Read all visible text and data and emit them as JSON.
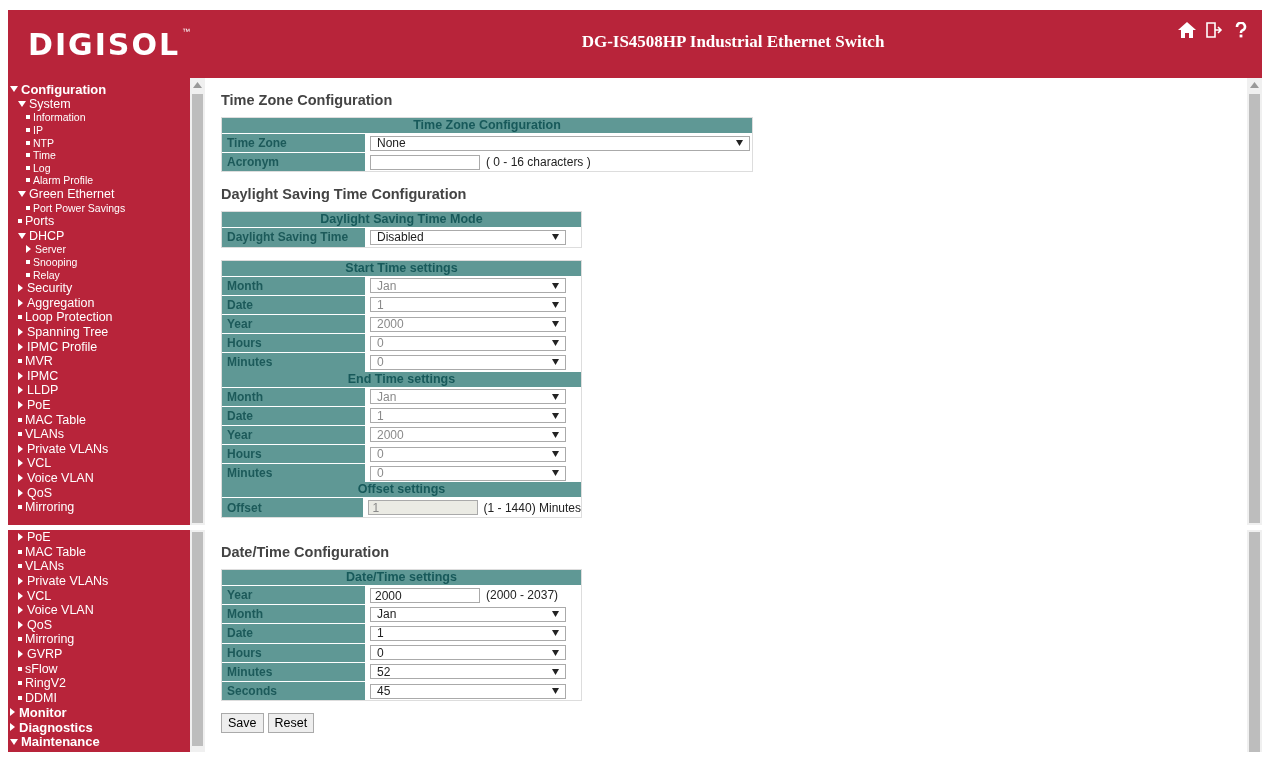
{
  "header": {
    "logo": "DIGISOL",
    "logo_mark": "™",
    "title": "DG-IS4508HP Industrial Ethernet Switch"
  },
  "top_panel": {
    "sidebar": {
      "items": [
        {
          "label": "Configuration",
          "kind": "folder",
          "expanded": true,
          "children": [
            {
              "label": "System",
              "kind": "folder",
              "expanded": true,
              "children": [
                {
                  "label": "Information",
                  "kind": "page"
                },
                {
                  "label": "IP",
                  "kind": "page"
                },
                {
                  "label": "NTP",
                  "kind": "page"
                },
                {
                  "label": "Time",
                  "kind": "page"
                },
                {
                  "label": "Log",
                  "kind": "page"
                },
                {
                  "label": "Alarm Profile",
                  "kind": "page"
                }
              ]
            },
            {
              "label": "Green Ethernet",
              "kind": "folder",
              "expanded": true,
              "children": [
                {
                  "label": "Port Power Savings",
                  "kind": "page"
                }
              ]
            },
            {
              "label": "Ports",
              "kind": "page"
            },
            {
              "label": "DHCP",
              "kind": "folder",
              "expanded": true,
              "children": [
                {
                  "label": "Server",
                  "kind": "folder",
                  "expanded": false
                },
                {
                  "label": "Snooping",
                  "kind": "page"
                },
                {
                  "label": "Relay",
                  "kind": "page"
                }
              ]
            },
            {
              "label": "Security",
              "kind": "folder",
              "expanded": false
            },
            {
              "label": "Aggregation",
              "kind": "folder",
              "expanded": false
            },
            {
              "label": "Loop Protection",
              "kind": "page"
            },
            {
              "label": "Spanning Tree",
              "kind": "folder",
              "expanded": false
            },
            {
              "label": "IPMC Profile",
              "kind": "folder",
              "expanded": false
            },
            {
              "label": "MVR",
              "kind": "page"
            },
            {
              "label": "IPMC",
              "kind": "folder",
              "expanded": false
            },
            {
              "label": "LLDP",
              "kind": "folder",
              "expanded": false
            },
            {
              "label": "PoE",
              "kind": "folder",
              "expanded": false
            },
            {
              "label": "MAC Table",
              "kind": "page"
            },
            {
              "label": "VLANs",
              "kind": "page"
            },
            {
              "label": "Private VLANs",
              "kind": "folder",
              "expanded": false
            },
            {
              "label": "VCL",
              "kind": "folder",
              "expanded": false
            },
            {
              "label": "Voice VLAN",
              "kind": "folder",
              "expanded": false
            },
            {
              "label": "QoS",
              "kind": "folder",
              "expanded": false
            },
            {
              "label": "Mirroring",
              "kind": "page"
            }
          ]
        }
      ]
    },
    "sections": [
      {
        "title": "Time Zone Configuration",
        "tables": [
          {
            "groups": [
              {
                "heading": "Time Zone Configuration",
                "rows": [
                  {
                    "label": "Time Zone",
                    "kind": "select",
                    "value": "None",
                    "disabled": false
                  },
                  {
                    "label": "Acronym",
                    "kind": "input",
                    "value": "",
                    "hint": "( 0 - 16 characters )",
                    "disabled": false
                  }
                ]
              }
            ]
          }
        ]
      },
      {
        "title": "Daylight Saving Time Configuration",
        "tables": [
          {
            "groups": [
              {
                "heading": "Daylight Saving Time Mode",
                "rows": [
                  {
                    "label": "Daylight Saving Time",
                    "kind": "select",
                    "value": "Disabled",
                    "disabled": false
                  }
                ]
              }
            ]
          },
          {
            "groups": [
              {
                "heading": "Start Time settings",
                "rows": [
                  {
                    "label": "Month",
                    "kind": "select",
                    "value": "Jan",
                    "disabled": true
                  },
                  {
                    "label": "Date",
                    "kind": "select",
                    "value": "1",
                    "disabled": true
                  },
                  {
                    "label": "Year",
                    "kind": "select",
                    "value": "2000",
                    "disabled": true
                  },
                  {
                    "label": "Hours",
                    "kind": "select",
                    "value": "0",
                    "disabled": true
                  },
                  {
                    "label": "Minutes",
                    "kind": "select",
                    "value": "0",
                    "disabled": true
                  }
                ]
              },
              {
                "heading": "End Time settings",
                "rows": [
                  {
                    "label": "Month",
                    "kind": "select",
                    "value": "Jan",
                    "disabled": true
                  },
                  {
                    "label": "Date",
                    "kind": "select",
                    "value": "1",
                    "disabled": true
                  },
                  {
                    "label": "Year",
                    "kind": "select",
                    "value": "2000",
                    "disabled": true
                  },
                  {
                    "label": "Hours",
                    "kind": "select",
                    "value": "0",
                    "disabled": true
                  },
                  {
                    "label": "Minutes",
                    "kind": "select",
                    "value": "0",
                    "disabled": true
                  }
                ]
              },
              {
                "heading": "Offset settings",
                "rows": [
                  {
                    "label": "Offset",
                    "kind": "input",
                    "value": "1",
                    "hint": "(1 - 1440) Minutes",
                    "disabled": true
                  }
                ]
              }
            ]
          }
        ]
      }
    ]
  },
  "bottom_panel": {
    "sidebar": {
      "continued_items": [
        {
          "label": "PoE",
          "kind": "folder",
          "expanded": false
        },
        {
          "label": "MAC Table",
          "kind": "page"
        },
        {
          "label": "VLANs",
          "kind": "page"
        },
        {
          "label": "Private VLANs",
          "kind": "folder",
          "expanded": false
        },
        {
          "label": "VCL",
          "kind": "folder",
          "expanded": false
        },
        {
          "label": "Voice VLAN",
          "kind": "folder",
          "expanded": false
        },
        {
          "label": "QoS",
          "kind": "folder",
          "expanded": false
        },
        {
          "label": "Mirroring",
          "kind": "page"
        },
        {
          "label": "GVRP",
          "kind": "folder",
          "expanded": false
        },
        {
          "label": "sFlow",
          "kind": "page"
        },
        {
          "label": "RingV2",
          "kind": "page"
        },
        {
          "label": "DDMI",
          "kind": "page"
        }
      ],
      "items": [
        {
          "label": "Monitor",
          "kind": "folder",
          "expanded": false
        },
        {
          "label": "Diagnostics",
          "kind": "folder",
          "expanded": false
        },
        {
          "label": "Maintenance",
          "kind": "folder",
          "expanded": true
        }
      ]
    },
    "sections": [
      {
        "title": "Date/Time Configuration",
        "tables": [
          {
            "groups": [
              {
                "heading": "Date/Time settings",
                "rows": [
                  {
                    "label": "Year",
                    "kind": "input",
                    "value": "2000",
                    "hint": "(2000 - 2037)",
                    "disabled": false
                  },
                  {
                    "label": "Month",
                    "kind": "select",
                    "value": "Jan",
                    "disabled": false
                  },
                  {
                    "label": "Date",
                    "kind": "select",
                    "value": "1",
                    "disabled": false
                  },
                  {
                    "label": "Hours",
                    "kind": "select",
                    "value": "0",
                    "disabled": false
                  },
                  {
                    "label": "Minutes",
                    "kind": "select",
                    "value": "52",
                    "disabled": false
                  },
                  {
                    "label": "Seconds",
                    "kind": "select",
                    "value": "45",
                    "disabled": false
                  }
                ]
              }
            ]
          }
        ]
      }
    ],
    "buttons": [
      "Save",
      "Reset"
    ]
  }
}
